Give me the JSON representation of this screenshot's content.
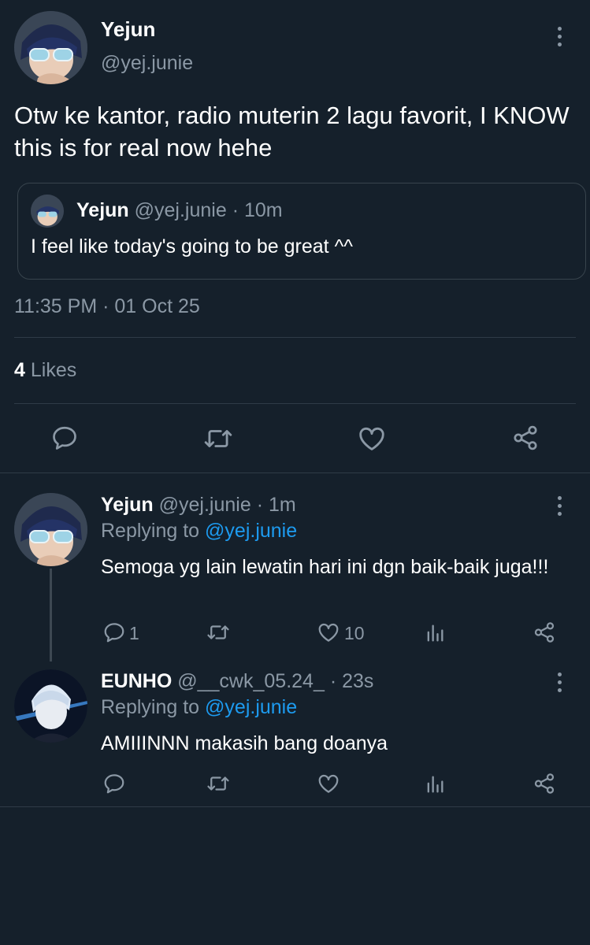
{
  "tweet": {
    "name": "Yejun",
    "handle": "@yej.junie",
    "text": "Otw ke kantor, radio muterin 2 lagu favorit, I KNOW this is for real now hehe",
    "quote": {
      "name": "Yejun",
      "handle": "@yej.junie",
      "time": "· 10m",
      "text": "I feel like today's going to be great ^^"
    },
    "timestamp": "11:35 PM · 01 Oct 25",
    "likes_count": "4",
    "likes_label": "Likes"
  },
  "replies": [
    {
      "name": "Yejun",
      "handle": "@yej.junie",
      "time": "· 1m",
      "replying_prefix": "Replying to",
      "replying_to": "@yej.junie",
      "text": "Semoga yg lain lewatin hari ini dgn baik-baik juga!!!",
      "reply_count": "1",
      "like_count": "10"
    },
    {
      "name": "EUNHO",
      "handle": "@__cwk_05.24_",
      "time": "· 23s",
      "replying_prefix": "Replying to",
      "replying_to": "@yej.junie",
      "text": "AMIIINNN makasih bang doanya",
      "reply_count": "",
      "like_count": ""
    }
  ],
  "colors": {
    "background": "#15202b",
    "text": "#ffffff",
    "muted": "#8b98a5",
    "link": "#1d9bf0",
    "divider": "#2f3b47"
  },
  "icons": [
    "more-icon",
    "reply-icon",
    "retweet-icon",
    "like-icon",
    "share-icon",
    "analytics-icon"
  ]
}
